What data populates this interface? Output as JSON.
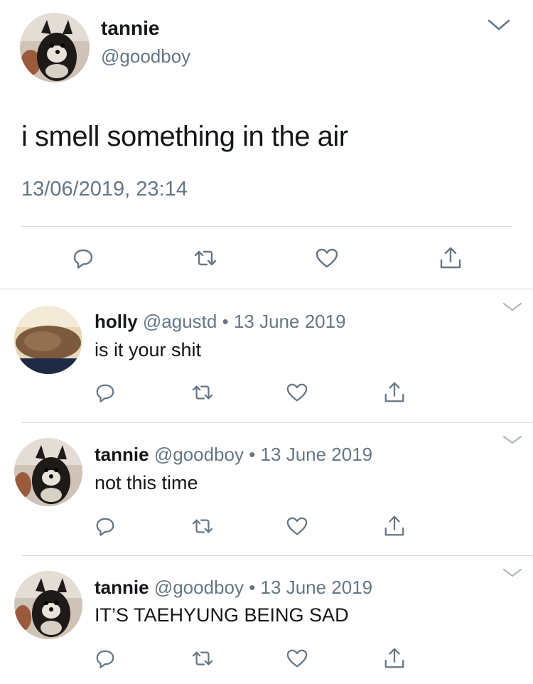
{
  "main_tweet": {
    "display_name": "tannie",
    "handle": "@goodboy",
    "text": "i smell something in the air",
    "timestamp": "13/06/2019, 23:14",
    "avatar": "pomeranian-dog-photo"
  },
  "replies": [
    {
      "display_name": "holly",
      "handle": "@agustd",
      "separator": "•",
      "date": "13 June 2019",
      "text": "is it your shit",
      "avatar": "brown-fluffy-dog-photo"
    },
    {
      "display_name": "tannie",
      "handle": "@goodboy",
      "separator": "•",
      "date": "13 June 2019",
      "text": "not this time",
      "avatar": "pomeranian-dog-photo"
    },
    {
      "display_name": "tannie",
      "handle": "@goodboy",
      "separator": "•",
      "date": "13 June 2019",
      "text": "IT’S TAEHYUNG BEING SAD",
      "avatar": "pomeranian-dog-photo"
    }
  ],
  "icons": {
    "reply": "reply-icon",
    "retweet": "retweet-icon",
    "like": "heart-icon",
    "share": "share-icon",
    "more": "chevron-down-icon"
  },
  "colors": {
    "text": "#14171a",
    "muted": "#657786",
    "divider": "#d6d9dc",
    "icon": "#657786"
  }
}
